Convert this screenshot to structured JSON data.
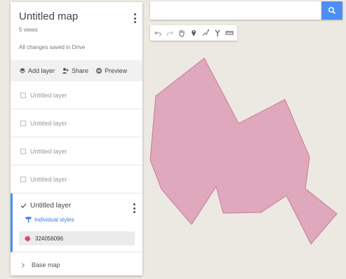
{
  "map": {
    "title": "Untitled map",
    "views": "5 views",
    "save_status": "All changes saved in Drive"
  },
  "actions": {
    "add_layer": "Add layer",
    "share": "Share",
    "preview": "Preview"
  },
  "layers": [
    {
      "label": "Untitled layer"
    },
    {
      "label": "Untitled layer"
    },
    {
      "label": "Untitled layer"
    },
    {
      "label": "Untitled layer"
    }
  ],
  "active_layer": {
    "label": "Untitled layer",
    "style_label": "Individual styles",
    "feature_label": "324056096"
  },
  "base_map": {
    "label": "Base map"
  },
  "search": {
    "value": "",
    "placeholder": ""
  },
  "toolbar_icons": [
    "undo-icon",
    "redo-icon",
    "hand-icon",
    "marker-icon",
    "draw-line-icon",
    "route-icon",
    "ruler-icon"
  ],
  "colors": {
    "accent": "#4d8ef6",
    "polygon_fill": "#e0a8bd",
    "polygon_stroke": "#c9879f",
    "map_background": "#ece9e3",
    "feature_marker": "#d9466e"
  }
}
